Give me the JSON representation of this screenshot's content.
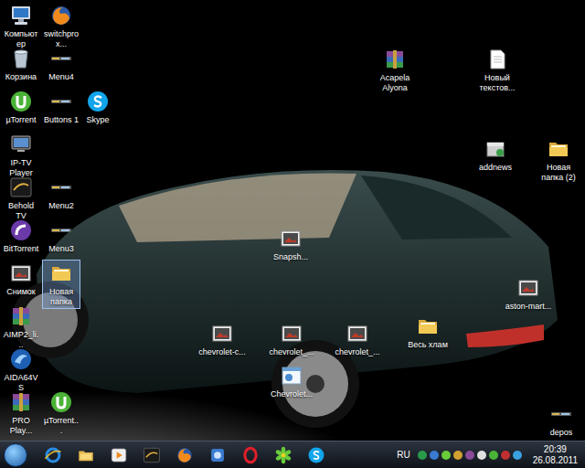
{
  "desktop": {
    "icons": [
      {
        "label": "Компьютер",
        "selected": false
      },
      {
        "label": "switchprox...",
        "selected": false
      },
      {
        "label": "Корзина",
        "selected": false
      },
      {
        "label": "Menu4",
        "selected": false
      },
      {
        "label": "µTorrent",
        "selected": false
      },
      {
        "label": "Buttons 1",
        "selected": false
      },
      {
        "label": "Skype",
        "selected": false
      },
      {
        "label": "IP-TV Player",
        "selected": false
      },
      {
        "label": "Behold TV",
        "selected": false
      },
      {
        "label": "Menu2",
        "selected": false
      },
      {
        "label": "BitTorrent",
        "selected": false
      },
      {
        "label": "Menu3",
        "selected": false
      },
      {
        "label": "Снимок",
        "selected": false
      },
      {
        "label": "Новая папка",
        "selected": true
      },
      {
        "label": "AIMP2_li...",
        "selected": false
      },
      {
        "label": "AIDA64VS",
        "selected": false
      },
      {
        "label": "PRO Play...",
        "selected": false
      },
      {
        "label": "µTorrent...",
        "selected": false
      },
      {
        "label": "Acapela Alyona",
        "selected": false
      },
      {
        "label": "Новый текстов...",
        "selected": false
      },
      {
        "label": "addnews",
        "selected": false
      },
      {
        "label": "Новая папка (2)",
        "selected": false
      },
      {
        "label": "Snapsh...",
        "selected": false
      },
      {
        "label": "aston-mart...",
        "selected": false
      },
      {
        "label": "chevrolet-c...",
        "selected": false
      },
      {
        "label": "chevrolet_...",
        "selected": false
      },
      {
        "label": "chevrolet_...",
        "selected": false
      },
      {
        "label": "Весь хлам",
        "selected": false
      },
      {
        "label": "Chevrolet...",
        "selected": false
      },
      {
        "label": "depos",
        "selected": false
      }
    ]
  },
  "taskbar": {
    "language": "RU",
    "clock": {
      "time": "20:39",
      "date": "26.08.2011"
    }
  }
}
